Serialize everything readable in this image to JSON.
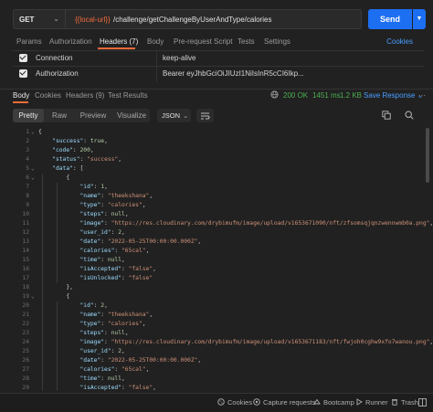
{
  "request": {
    "method": "GET",
    "url_variable": "{{local-url}}",
    "url_path": "/challenge/getChallengeByUserAndType/calories",
    "send_label": "Send"
  },
  "request_tabs": {
    "params": "Params",
    "authorization": "Authorization",
    "headers": "Headers (7)",
    "body": "Body",
    "prerequest": "Pre-request Script",
    "tests": "Tests",
    "settings": "Settings",
    "cookies": "Cookies"
  },
  "headers": [
    {
      "key": "Connection",
      "value": "keep-alive"
    },
    {
      "key": "Authorization",
      "value": "Bearer eyJhbGciOiJIUzI1NiIsInR5cCI6Ikp..."
    }
  ],
  "response_tabs": {
    "body": "Body",
    "cookies": "Cookies",
    "headers": "Headers (9)",
    "test_results": "Test Results"
  },
  "response_status": {
    "code": "200 OK",
    "time": "1451 ms",
    "size": "1.2 KB",
    "save": "Save Response"
  },
  "view_modes": {
    "pretty": "Pretty",
    "raw": "Raw",
    "preview": "Preview",
    "visualize": "Visualize",
    "format": "JSON"
  },
  "code_lines": [
    {
      "n": "1",
      "t": "{"
    },
    {
      "n": "2",
      "t": "    \"success\": true,"
    },
    {
      "n": "3",
      "t": "    \"code\": 200,"
    },
    {
      "n": "4",
      "t": "    \"status\": \"success\","
    },
    {
      "n": "5",
      "t": "    \"data\": ["
    },
    {
      "n": "6",
      "t": "        {"
    },
    {
      "n": "7",
      "t": "            \"id\": 1,"
    },
    {
      "n": "8",
      "t": "            \"name\": \"theekshana\","
    },
    {
      "n": "9",
      "t": "            \"type\": \"calories\","
    },
    {
      "n": "10",
      "t": "            \"steps\": null,"
    },
    {
      "n": "11",
      "t": "            \"image\": \"https://res.cloudinary.com/drybimufm/image/upload/v1653671090/nft/zfsomsqjqnzwennwmb0a.png\","
    },
    {
      "n": "12",
      "t": "            \"user_id\": 2,"
    },
    {
      "n": "13",
      "t": "            \"date\": \"2022-05-25T00:00:00.000Z\","
    },
    {
      "n": "14",
      "t": "            \"calories\": \"65cal\","
    },
    {
      "n": "15",
      "t": "            \"time\": null,"
    },
    {
      "n": "16",
      "t": "            \"isAccepted\": \"false\","
    },
    {
      "n": "17",
      "t": "            \"isUnlocked\": \"false\""
    },
    {
      "n": "18",
      "t": "        },"
    },
    {
      "n": "19",
      "t": "        {"
    },
    {
      "n": "20",
      "t": "            \"id\": 2,"
    },
    {
      "n": "21",
      "t": "            \"name\": \"theekshana\","
    },
    {
      "n": "22",
      "t": "            \"type\": \"calories\","
    },
    {
      "n": "23",
      "t": "            \"steps\": null,"
    },
    {
      "n": "24",
      "t": "            \"image\": \"https://res.cloudinary.com/drybimufm/image/upload/v1653671183/nft/fwjoh0cghw9xfo7wanou.png\","
    },
    {
      "n": "25",
      "t": "            \"user_id\": 2,"
    },
    {
      "n": "26",
      "t": "            \"date\": \"2022-05-25T00:00:00.000Z\","
    },
    {
      "n": "27",
      "t": "            \"calories\": \"65cal\","
    },
    {
      "n": "28",
      "t": "            \"time\": null,"
    },
    {
      "n": "29",
      "t": "            \"isAccepted\": \"false\","
    }
  ],
  "status_bar": {
    "cookies": "Cookies",
    "capture": "Capture requests",
    "bootcamp": "Bootcamp",
    "runner": "Runner",
    "trash": "Trash"
  },
  "colors": {
    "accent": "#f26b3a",
    "send": "#1d6ff2",
    "success": "#4caf50",
    "link": "#4a9eff"
  }
}
